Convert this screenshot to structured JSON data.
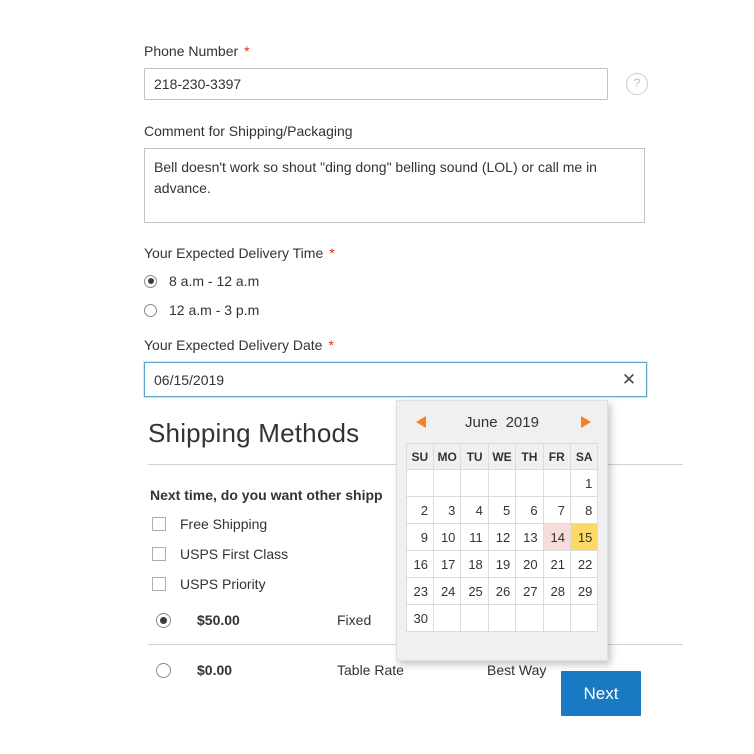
{
  "form": {
    "phone": {
      "label": "Phone Number",
      "required_marker": "*",
      "value": "218-230-3397",
      "placeholder": "",
      "help_icon": "question-mark-circle-icon",
      "help_glyph": "?"
    },
    "comment": {
      "label": "Comment for Shipping/Packaging",
      "value": "Bell doesn't work so shout \"ding dong\" belling sound (LOL) or call me in advance.",
      "placeholder": ""
    },
    "delivery_time": {
      "label": "Your Expected Delivery Time",
      "required_marker": "*",
      "options": [
        {
          "label": "8 a.m - 12 a.m",
          "selected": true
        },
        {
          "label": "12 a.m - 3 p.m",
          "selected": false
        }
      ]
    },
    "delivery_date": {
      "label": "Your Expected Delivery Date",
      "required_marker": "*",
      "value": "06/15/2019",
      "placeholder": "",
      "clear_glyph": "✕",
      "focused": true
    }
  },
  "shipping": {
    "heading": "Shipping Methods",
    "question": "Next time, do you want other shipp",
    "checkboxes": [
      {
        "label": "Free Shipping",
        "checked": false
      },
      {
        "label": "USPS First Class",
        "checked": false
      },
      {
        "label": "USPS Priority",
        "checked": false
      }
    ],
    "rates": [
      {
        "price": "$50.00",
        "carrier": "Fixed",
        "method": "",
        "selected": true
      },
      {
        "price": "$0.00",
        "carrier": "Table Rate",
        "method": "Best Way",
        "selected": false
      }
    ]
  },
  "actions": {
    "next_label": "Next"
  },
  "datepicker": {
    "month": "June",
    "year": "2019",
    "prev_icon": "triangle-left-icon",
    "next_icon": "triangle-right-icon",
    "weekdays": [
      "SU",
      "MO",
      "TU",
      "WE",
      "TH",
      "FR",
      "SA"
    ],
    "weeks": [
      [
        "",
        "",
        "",
        "",
        "",
        "",
        "1"
      ],
      [
        "2",
        "3",
        "4",
        "5",
        "6",
        "7",
        "8"
      ],
      [
        "9",
        "10",
        "11",
        "12",
        "13",
        "14",
        "15"
      ],
      [
        "16",
        "17",
        "18",
        "19",
        "20",
        "21",
        "22"
      ],
      [
        "23",
        "24",
        "25",
        "26",
        "27",
        "28",
        "29"
      ],
      [
        "30",
        "",
        "",
        "",
        "",
        "",
        ""
      ]
    ],
    "today": "14",
    "selected": "15"
  },
  "colors": {
    "required_star": "#e02b27",
    "primary_button": "#1979c3",
    "datepicker_arrow": "#f58220",
    "selected_day": "#fcd966",
    "today_day": "#f8dcdc",
    "focus_border": "#5fa4cc"
  }
}
